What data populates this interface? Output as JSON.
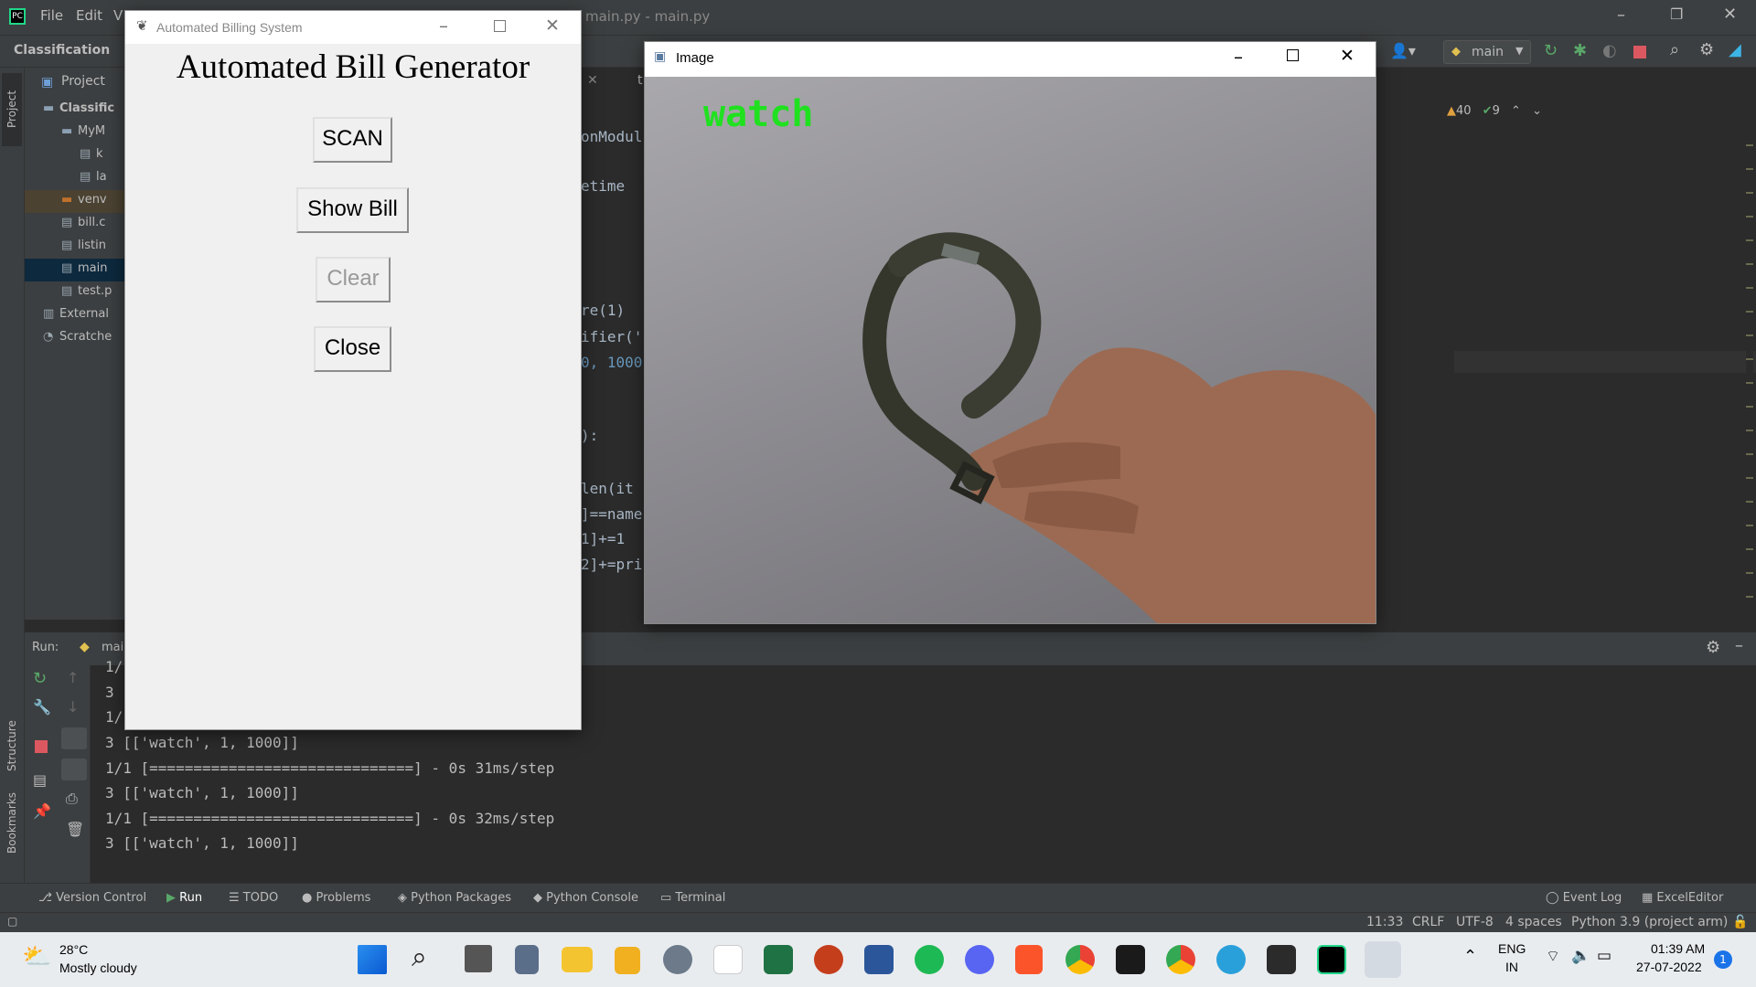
{
  "ide": {
    "menu": [
      "File",
      "Edit",
      "V"
    ],
    "window_title": "main.py - main.py",
    "breadcrumb": "Classification",
    "run_config": "main",
    "project_tab": "Project",
    "tree": [
      {
        "label": "Classific",
        "indent": 0,
        "type": "folder"
      },
      {
        "label": "MyM",
        "indent": 1,
        "type": "folder"
      },
      {
        "label": "k",
        "indent": 2,
        "type": "file"
      },
      {
        "label": "la",
        "indent": 2,
        "type": "file"
      },
      {
        "label": "venv",
        "indent": 1,
        "type": "folder-orange"
      },
      {
        "label": "bill.c",
        "indent": 1,
        "type": "file"
      },
      {
        "label": "listin",
        "indent": 1,
        "type": "file"
      },
      {
        "label": "main",
        "indent": 1,
        "type": "file"
      },
      {
        "label": "test.p",
        "indent": 1,
        "type": "file"
      },
      {
        "label": "External",
        "indent": 0,
        "type": "lib"
      },
      {
        "label": "Scratche",
        "indent": 0,
        "type": "scratch"
      }
    ],
    "editor_tab": "t",
    "code_fragments": [
      "onModul",
      "etime",
      "re(1)",
      "ifier('",
      "0, 1000",
      "):",
      "len(it",
      "]==name",
      "1]+=1",
      "2]+=pri"
    ],
    "warnings": "40",
    "checks": "9",
    "side_labels": {
      "structure": "Structure",
      "bookmarks": "Bookmarks",
      "project": "Project"
    },
    "run_label": "Run:",
    "run_tab": "mai",
    "console": [
      "1/",
      "3",
      "1/",
      "3 [['watch', 1, 1000]]",
      "1/1 [==============================] - 0s 31ms/step",
      "3 [['watch', 1, 1000]]",
      "1/1 [==============================] - 0s 32ms/step",
      "3 [['watch', 1, 1000]]"
    ],
    "tool_tabs": [
      "Version Control",
      "Run",
      "TODO",
      "Problems",
      "Python Packages",
      "Python Console",
      "Terminal"
    ],
    "tool_right": [
      "Event Log",
      "ExcelEditor"
    ],
    "status": {
      "pos": "11:33",
      "eol": "CRLF",
      "enc": "UTF-8",
      "indent": "4 spaces",
      "interpreter": "Python 3.9 (project arm)"
    }
  },
  "tk": {
    "title": "Automated Billing System",
    "heading": "Automated Bill Generator",
    "buttons": {
      "scan": "SCAN",
      "show_bill": "Show Bill",
      "clear": "Clear",
      "close": "Close"
    }
  },
  "image_window": {
    "title": "Image",
    "label": "watch"
  },
  "taskbar": {
    "temp": "28°C",
    "weather": "Mostly cloudy",
    "lang1": "ENG",
    "lang2": "IN",
    "time": "01:39 AM",
    "date": "27-07-2022",
    "notif": "1"
  }
}
